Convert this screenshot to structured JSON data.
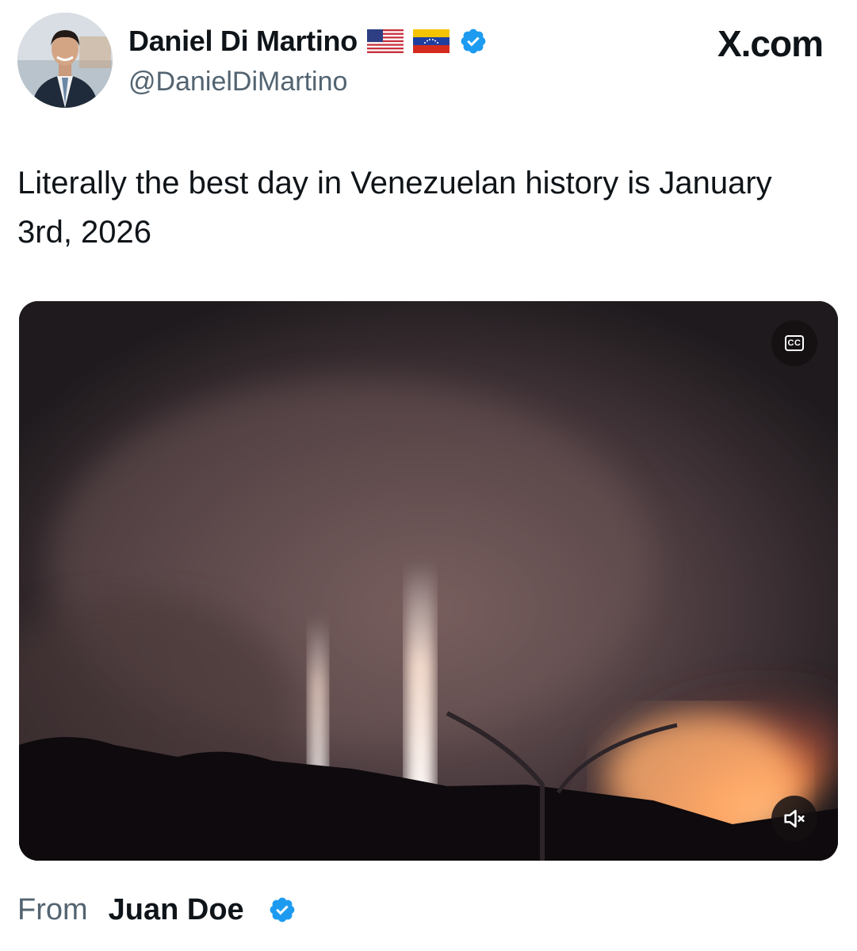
{
  "author": {
    "display_name": "Daniel Di Martino",
    "handle": "@DanielDiMartino",
    "flags": [
      "us-flag-icon",
      "venezuela-flag-icon"
    ],
    "verified": true
  },
  "brand": {
    "logo_text": "X.com"
  },
  "tweet": {
    "text": "Literally the best day in Venezuelan history is January 3rd, 2026"
  },
  "media": {
    "type": "video",
    "captions_label": "CC",
    "controls": [
      "captions-icon",
      "mute-icon"
    ]
  },
  "source": {
    "label": "From",
    "name": "Juan Doe",
    "verified": true
  },
  "colors": {
    "verified_blue": "#1d9bf0",
    "text_primary": "#0f1419",
    "text_secondary": "#536471"
  }
}
